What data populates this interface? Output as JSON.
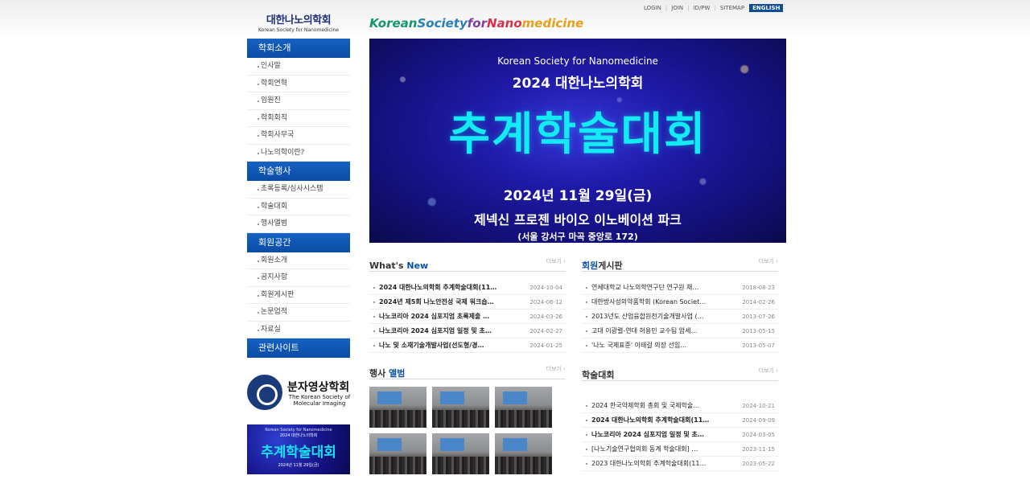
{
  "top_links": [
    "LOGIN",
    "JOIN",
    "ID/PW",
    "SITEMAP"
  ],
  "lang_button": "ENGLISH",
  "logo": {
    "ko": "대한나노의학회",
    "en": "Korean Society for Nanomedicine"
  },
  "site_title": {
    "segments": [
      {
        "text": "Korean ",
        "color": "#16966a"
      },
      {
        "text": "Society ",
        "color": "#2a7fb8"
      },
      {
        "text": "for ",
        "color": "#7c3fa0"
      },
      {
        "text": "Nano",
        "color": "#d8324a"
      },
      {
        "text": "medicine",
        "color": "#e8a01a"
      }
    ]
  },
  "sidebar": {
    "sections": [
      {
        "title": "학회소개",
        "items": [
          "인사말",
          "학회연혁",
          "임원진",
          "학회회칙",
          "학회사무국",
          "나노의학이란?"
        ]
      },
      {
        "title": "학술행사",
        "items": [
          "초록등록/심사시스템",
          "학술대회",
          "행사앨범"
        ]
      },
      {
        "title": "회원공간",
        "items": [
          "회원소개",
          "공지사항",
          "회원게시판",
          "논문업적",
          "자료실"
        ]
      },
      {
        "title": "관련사이트",
        "items": []
      }
    ]
  },
  "partner": {
    "name": "분자영상학회",
    "sub": "The Korean Society of Molecular Imaging"
  },
  "mini_banner": {
    "line1": "Korean Society for Nanomedicine",
    "line2": "2024 대한나노의학회",
    "title": "추계학술대회",
    "line3": "2024년 11월 29일(금)"
  },
  "hero": {
    "org_en": "Korean Society for Nanomedicine",
    "org_ko": "2024 대한나노의학회",
    "title": "추계학술대회",
    "date": "2024년 11월 29일(금)",
    "venue": "제넥신 프로젠 바이오 이노베이션 파크",
    "address": "(서울 강서구 마곡 중앙로 172)"
  },
  "more_label": "더보기 ›",
  "whats_new": {
    "title_plain": "What's ",
    "title_accent": "New",
    "rows": [
      {
        "title": "2024 대한나노의학회 추계학술대회(11…",
        "date": "2024-10-04"
      },
      {
        "title": "2024년 제5회 나노안전성 국제 워크숍…",
        "date": "2024-06-12"
      },
      {
        "title": "나노코리아 2024 심포지엄 초록제출 …",
        "date": "2024-03-26"
      },
      {
        "title": "나노코리아 2024 심포지엄 일정 및 초…",
        "date": "2024-02-27"
      },
      {
        "title": "나노 및 소재기술개발사업(선도형/경…",
        "date": "2024-01-25"
      }
    ]
  },
  "member_board": {
    "title_accent": "회원",
    "title_plain": "게시판",
    "rows": [
      {
        "title": "연세대학교 나노의학연구단 연구원 채…",
        "date": "2018-08-23"
      },
      {
        "title": "대한방사성의약품학회 (Korean Societ…",
        "date": "2014-02-26"
      },
      {
        "title": "2013년도 산업융합원천기술개발사업 (…",
        "date": "2013-07-26"
      },
      {
        "title": "고대 이광렬-연대 허용민 교수팀 암세…",
        "date": "2013-05-15"
      },
      {
        "title": "'나노 국제표준' 이태걸 의장 선임…",
        "date": "2013-05-07"
      }
    ]
  },
  "event_album": {
    "title_plain": "행사 ",
    "title_accent": "앨범",
    "photo_count_label": ""
  },
  "conference": {
    "title": "학술대회",
    "rows": [
      {
        "title": "2024 한국약제학회 총회 및 국제학술…",
        "date": "2024-10-21"
      },
      {
        "title": "2024 대한나노의학회 추계학술대회(11…",
        "date": "2024-09-09"
      },
      {
        "title": "나노코리아 2024 심포지엄 일정 및 초…",
        "date": "2024-03-05"
      },
      {
        "title": "[나노기술연구협의회 동계 학술대회] …",
        "date": "2023-11-15"
      },
      {
        "title": "2023 대한나노의학회 추계학술대회(11…",
        "date": "2023-05-22"
      }
    ]
  },
  "colors": {
    "primary": "#0d4c97",
    "accent_cyan": "#12eaf4",
    "hero_bg": "#1f1aa8"
  }
}
